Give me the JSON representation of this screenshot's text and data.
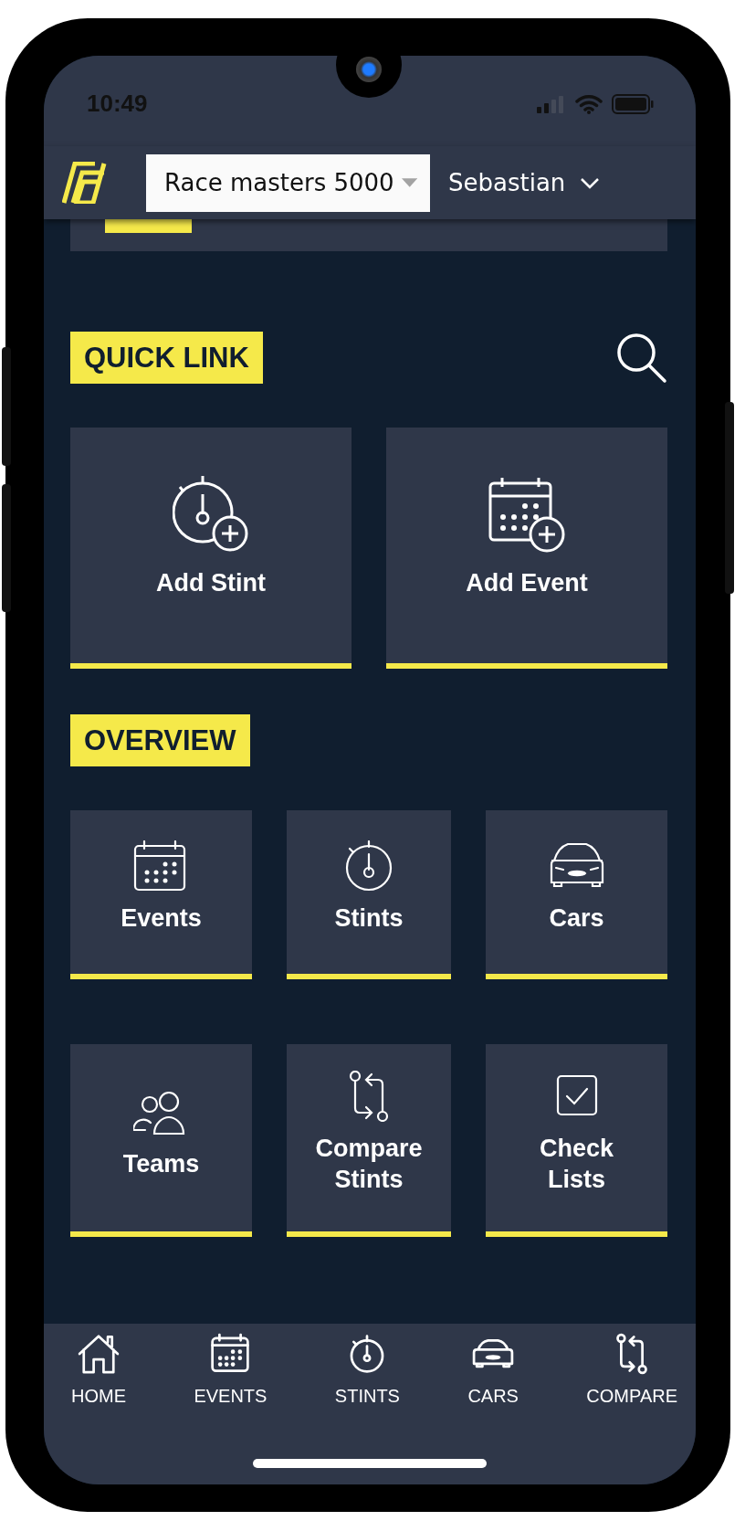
{
  "status_bar": {
    "time": "10:49"
  },
  "header": {
    "event_select": {
      "value": "Race masters 5000"
    },
    "user": "Sebastian"
  },
  "quick_link": {
    "title": "QUICK LINK",
    "cards": [
      {
        "label": "Add Stint"
      },
      {
        "label": "Add Event"
      }
    ]
  },
  "overview": {
    "title": "OVERVIEW",
    "tiles": [
      {
        "label": "Events"
      },
      {
        "label": "Stints"
      },
      {
        "label": "Cars"
      },
      {
        "label": "Teams"
      },
      {
        "label": "Compare Stints"
      },
      {
        "label": "Check Lists"
      }
    ]
  },
  "bottom_nav": [
    {
      "label": "HOME"
    },
    {
      "label": "EVENTS"
    },
    {
      "label": "STINTS"
    },
    {
      "label": "CARS"
    },
    {
      "label": "COMPARE"
    }
  ]
}
